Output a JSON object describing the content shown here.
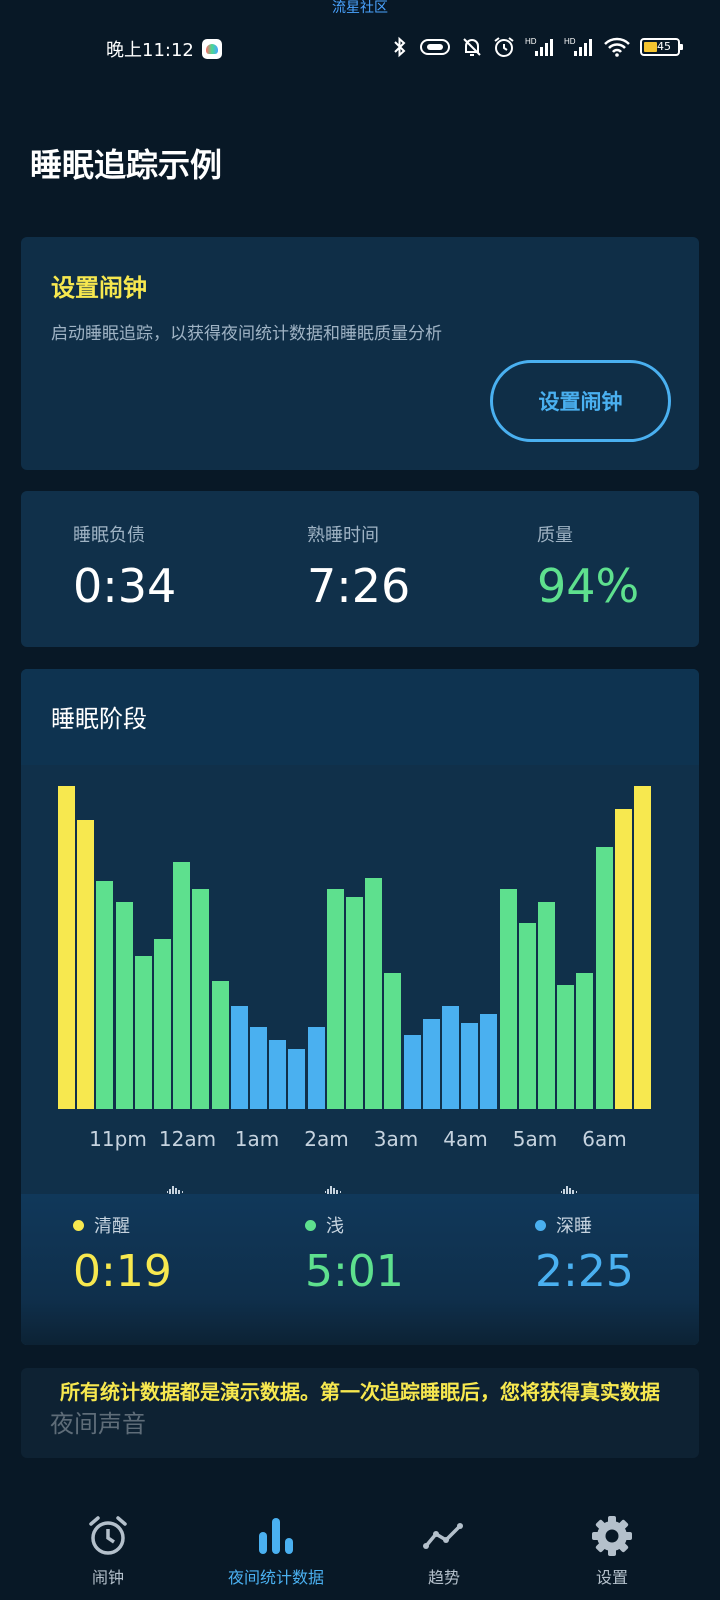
{
  "watermark": "流星社区",
  "status_bar": {
    "time": "晚上11:12",
    "battery": "45",
    "icons": [
      "bluetooth-icon",
      "vibrate-icon",
      "mute-icon",
      "alarm-icon",
      "signal-icon",
      "signal-icon",
      "wifi-icon",
      "battery-icon"
    ]
  },
  "page_title": "睡眠追踪示例",
  "alarm_card": {
    "title": "设置闹钟",
    "description": "启动睡眠追踪，以获得夜间统计数据和睡眠质量分析",
    "button_label": "设置闹钟"
  },
  "stats": [
    {
      "label": "睡眠负债",
      "value": "0:34"
    },
    {
      "label": "熟睡时间",
      "value": "7:26"
    },
    {
      "label": "质量",
      "value": "94%"
    }
  ],
  "phase_card": {
    "title": "睡眠阶段",
    "x_ticks": [
      "11pm",
      "12am",
      "1am",
      "2am",
      "3am",
      "4am",
      "5am",
      "6am"
    ],
    "legend": [
      {
        "label": "清醒",
        "value": "0:19",
        "color": "#f7e84f"
      },
      {
        "label": "浅",
        "value": "5:01",
        "color": "#5ee08e"
      },
      {
        "label": "深睡",
        "value": "2:25",
        "color": "#4ab0f0"
      }
    ]
  },
  "chart_data": {
    "type": "bar",
    "categories": [],
    "stage_colors": {
      "awake": "#f7e84f",
      "light": "#5ee08e",
      "deep": "#4ab0f0"
    },
    "values": [
      100,
      89.5,
      70.5,
      64,
      47.5,
      52.5,
      76.5,
      68,
      39.5,
      32,
      25.5,
      21.5,
      18.5,
      25.5,
      68,
      65.5,
      71.5,
      42,
      23,
      28,
      32,
      26.5,
      29.5,
      68,
      57.5,
      64,
      38.5,
      42,
      81,
      93,
      100
    ],
    "stages": [
      "awake",
      "awake",
      "light",
      "light",
      "light",
      "light",
      "light",
      "light",
      "light",
      "deep",
      "deep",
      "deep",
      "deep",
      "deep",
      "light",
      "light",
      "light",
      "light",
      "deep",
      "deep",
      "deep",
      "deep",
      "deep",
      "light",
      "light",
      "light",
      "light",
      "light",
      "light",
      "awake",
      "awake"
    ],
    "ylim": [
      0,
      100
    ]
  },
  "sound_card": {
    "title": "夜间声音"
  },
  "toast": "所有统计数据都是演示数据。第一次追踪睡眠后，您将获得真实数据",
  "bottom_nav": [
    {
      "label": "闹钟",
      "icon": "alarm-clock-icon",
      "active": false
    },
    {
      "label": "夜间统计数据",
      "icon": "bar-chart-icon",
      "active": true
    },
    {
      "label": "趋势",
      "icon": "trend-icon",
      "active": false
    },
    {
      "label": "设置",
      "icon": "gear-icon",
      "active": false
    }
  ]
}
